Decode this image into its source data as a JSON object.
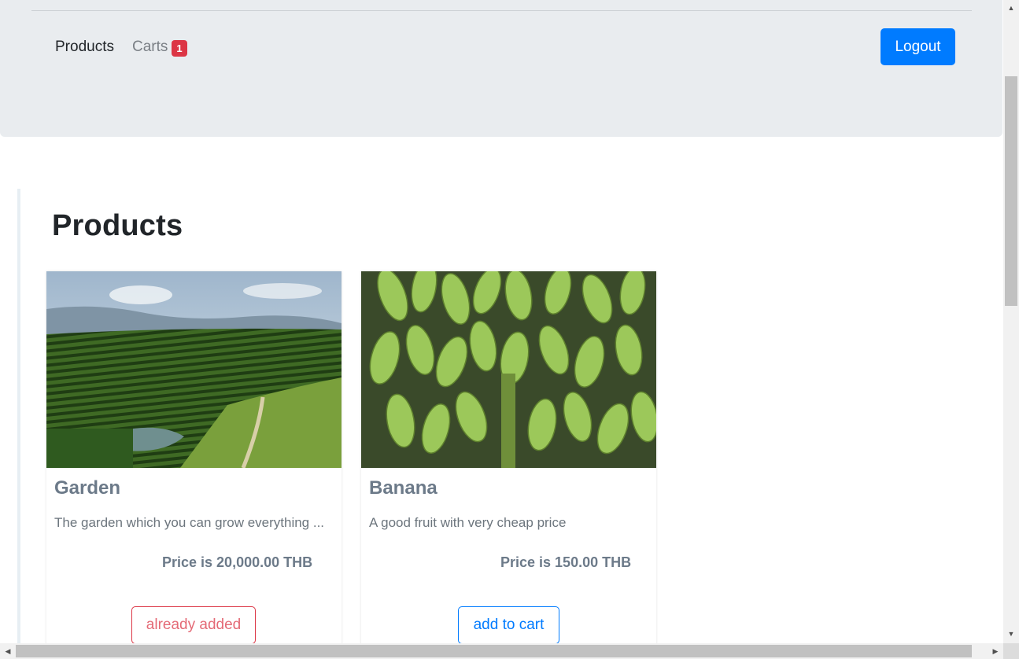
{
  "navbar": {
    "links": [
      {
        "label": "Products",
        "active": true
      },
      {
        "label": "Carts",
        "active": false
      }
    ],
    "cart_count": "1",
    "logout_label": "Logout"
  },
  "page": {
    "title": "Products"
  },
  "products": [
    {
      "name": "Garden",
      "description": "The garden which you can grow everything ...",
      "price": "Price is 20,000.00 THB",
      "button_label": "already added",
      "image": "garden-plantation-photo"
    },
    {
      "name": "Banana",
      "description": "A good fruit with very cheap price",
      "price": "Price is 150.00 THB",
      "button_label": "add to cart",
      "image": "banana-bunches-photo"
    }
  ],
  "colors": {
    "navbar_bg": "#e9ecef",
    "primary": "#007bff",
    "danger": "#dc3545",
    "muted_text": "#6c757d"
  }
}
